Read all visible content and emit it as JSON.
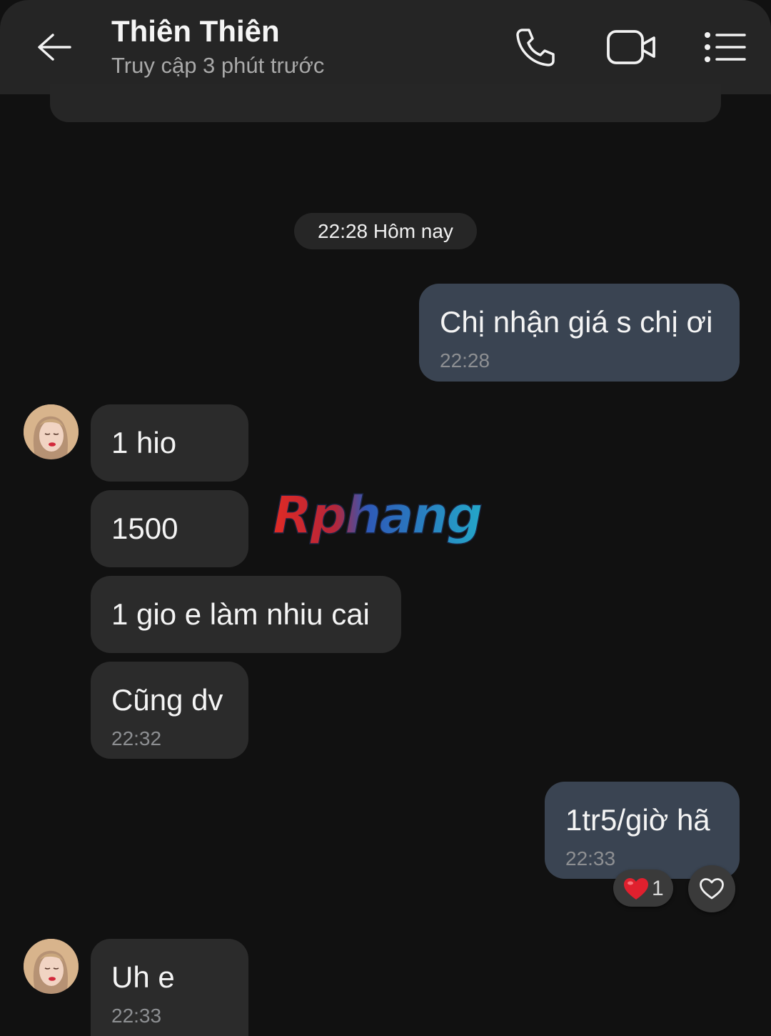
{
  "header": {
    "title": "Thiên Thiên",
    "status": "Truy cập 3 phút trước",
    "back_icon": "arrow-left-icon",
    "call_icon": "phone-icon",
    "video_icon": "video-camera-icon",
    "menu_icon": "list-menu-icon"
  },
  "chat": {
    "date_separator": "22:28 Hôm nay",
    "messages": [
      {
        "side": "out",
        "text": "Chị nhận giá s chị ơi",
        "time": "22:28"
      },
      {
        "side": "in",
        "text": "1 hio"
      },
      {
        "side": "in",
        "text": "1500"
      },
      {
        "side": "in",
        "text": "1 gio e làm nhiu cai"
      },
      {
        "side": "in",
        "text": "Cũng dv",
        "time": "22:32"
      },
      {
        "side": "out",
        "text": "1tr5/giờ hã",
        "time": "22:33",
        "reaction": {
          "icon": "heart-icon",
          "count": "1"
        }
      },
      {
        "side": "in",
        "text": "Uh e",
        "time": "22:33"
      }
    ]
  },
  "watermark": {
    "text": "Rphang"
  },
  "colors": {
    "background": "#111111",
    "header": "#252525",
    "incoming_bubble": "#2b2b2b",
    "outgoing_bubble": "#3a4452",
    "timestamp": "#8d8f92",
    "reaction_heart": "#e0202e"
  }
}
